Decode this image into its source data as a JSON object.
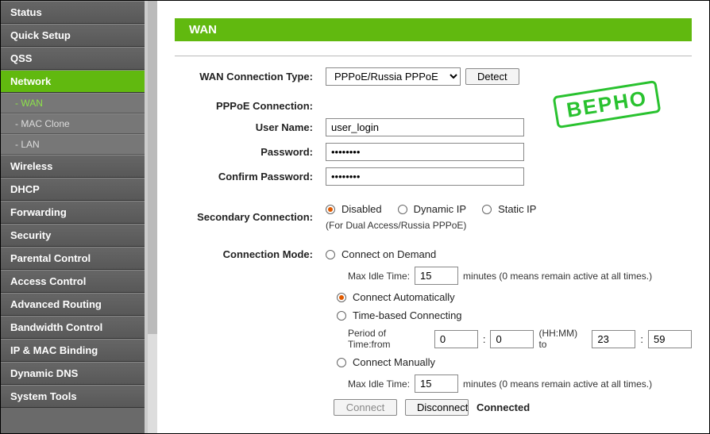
{
  "sidebar": [
    {
      "label": "Status",
      "type": "item"
    },
    {
      "label": "Quick Setup",
      "type": "item"
    },
    {
      "label": "QSS",
      "type": "item"
    },
    {
      "label": "Network",
      "type": "item",
      "active": true
    },
    {
      "label": "- WAN",
      "type": "sub",
      "active": true
    },
    {
      "label": "- MAC Clone",
      "type": "sub"
    },
    {
      "label": "- LAN",
      "type": "sub"
    },
    {
      "label": "Wireless",
      "type": "item"
    },
    {
      "label": "DHCP",
      "type": "item"
    },
    {
      "label": "Forwarding",
      "type": "item"
    },
    {
      "label": "Security",
      "type": "item"
    },
    {
      "label": "Parental Control",
      "type": "item"
    },
    {
      "label": "Access Control",
      "type": "item"
    },
    {
      "label": "Advanced Routing",
      "type": "item"
    },
    {
      "label": "Bandwidth Control",
      "type": "item"
    },
    {
      "label": "IP & MAC Binding",
      "type": "item"
    },
    {
      "label": "Dynamic DNS",
      "type": "item"
    },
    {
      "label": "System Tools",
      "type": "item"
    }
  ],
  "panel": {
    "title": "WAN"
  },
  "stamp": "BEPHO",
  "labels": {
    "wan_conn_type": "WAN Connection Type:",
    "pppoe_conn": "PPPoE Connection:",
    "user_name": "User Name:",
    "password": "Password:",
    "confirm_password": "Confirm Password:",
    "secondary_conn": "Secondary Connection:",
    "connection_mode": "Connection Mode:"
  },
  "values": {
    "conn_type_selected": "PPPoE/Russia PPPoE",
    "detect_btn": "Detect",
    "user_name": "user_login",
    "password": "••••••••",
    "confirm_password": "••••••••",
    "secondary_hint": "(For Dual Access/Russia PPPoE)",
    "max_idle_label": "Max Idle Time:",
    "max_idle_1": "15",
    "max_idle_2": "15",
    "minutes_hint": "minutes (0 means remain active at all times.)",
    "period_label": "Period of Time:from",
    "period_from_h": "0",
    "period_from_m": "0",
    "period_sep": ":",
    "period_hhmm_to": "(HH:MM) to",
    "period_to_h": "23",
    "period_to_m": "59",
    "connect_btn": "Connect",
    "disconnect_btn": "Disconnect",
    "status": "Connected"
  },
  "radios": {
    "secondary": {
      "disabled": "Disabled",
      "dynamic": "Dynamic IP",
      "static": "Static IP"
    },
    "mode": {
      "on_demand": "Connect on Demand",
      "auto": "Connect Automatically",
      "time": "Time-based Connecting",
      "manual": "Connect Manually"
    }
  }
}
